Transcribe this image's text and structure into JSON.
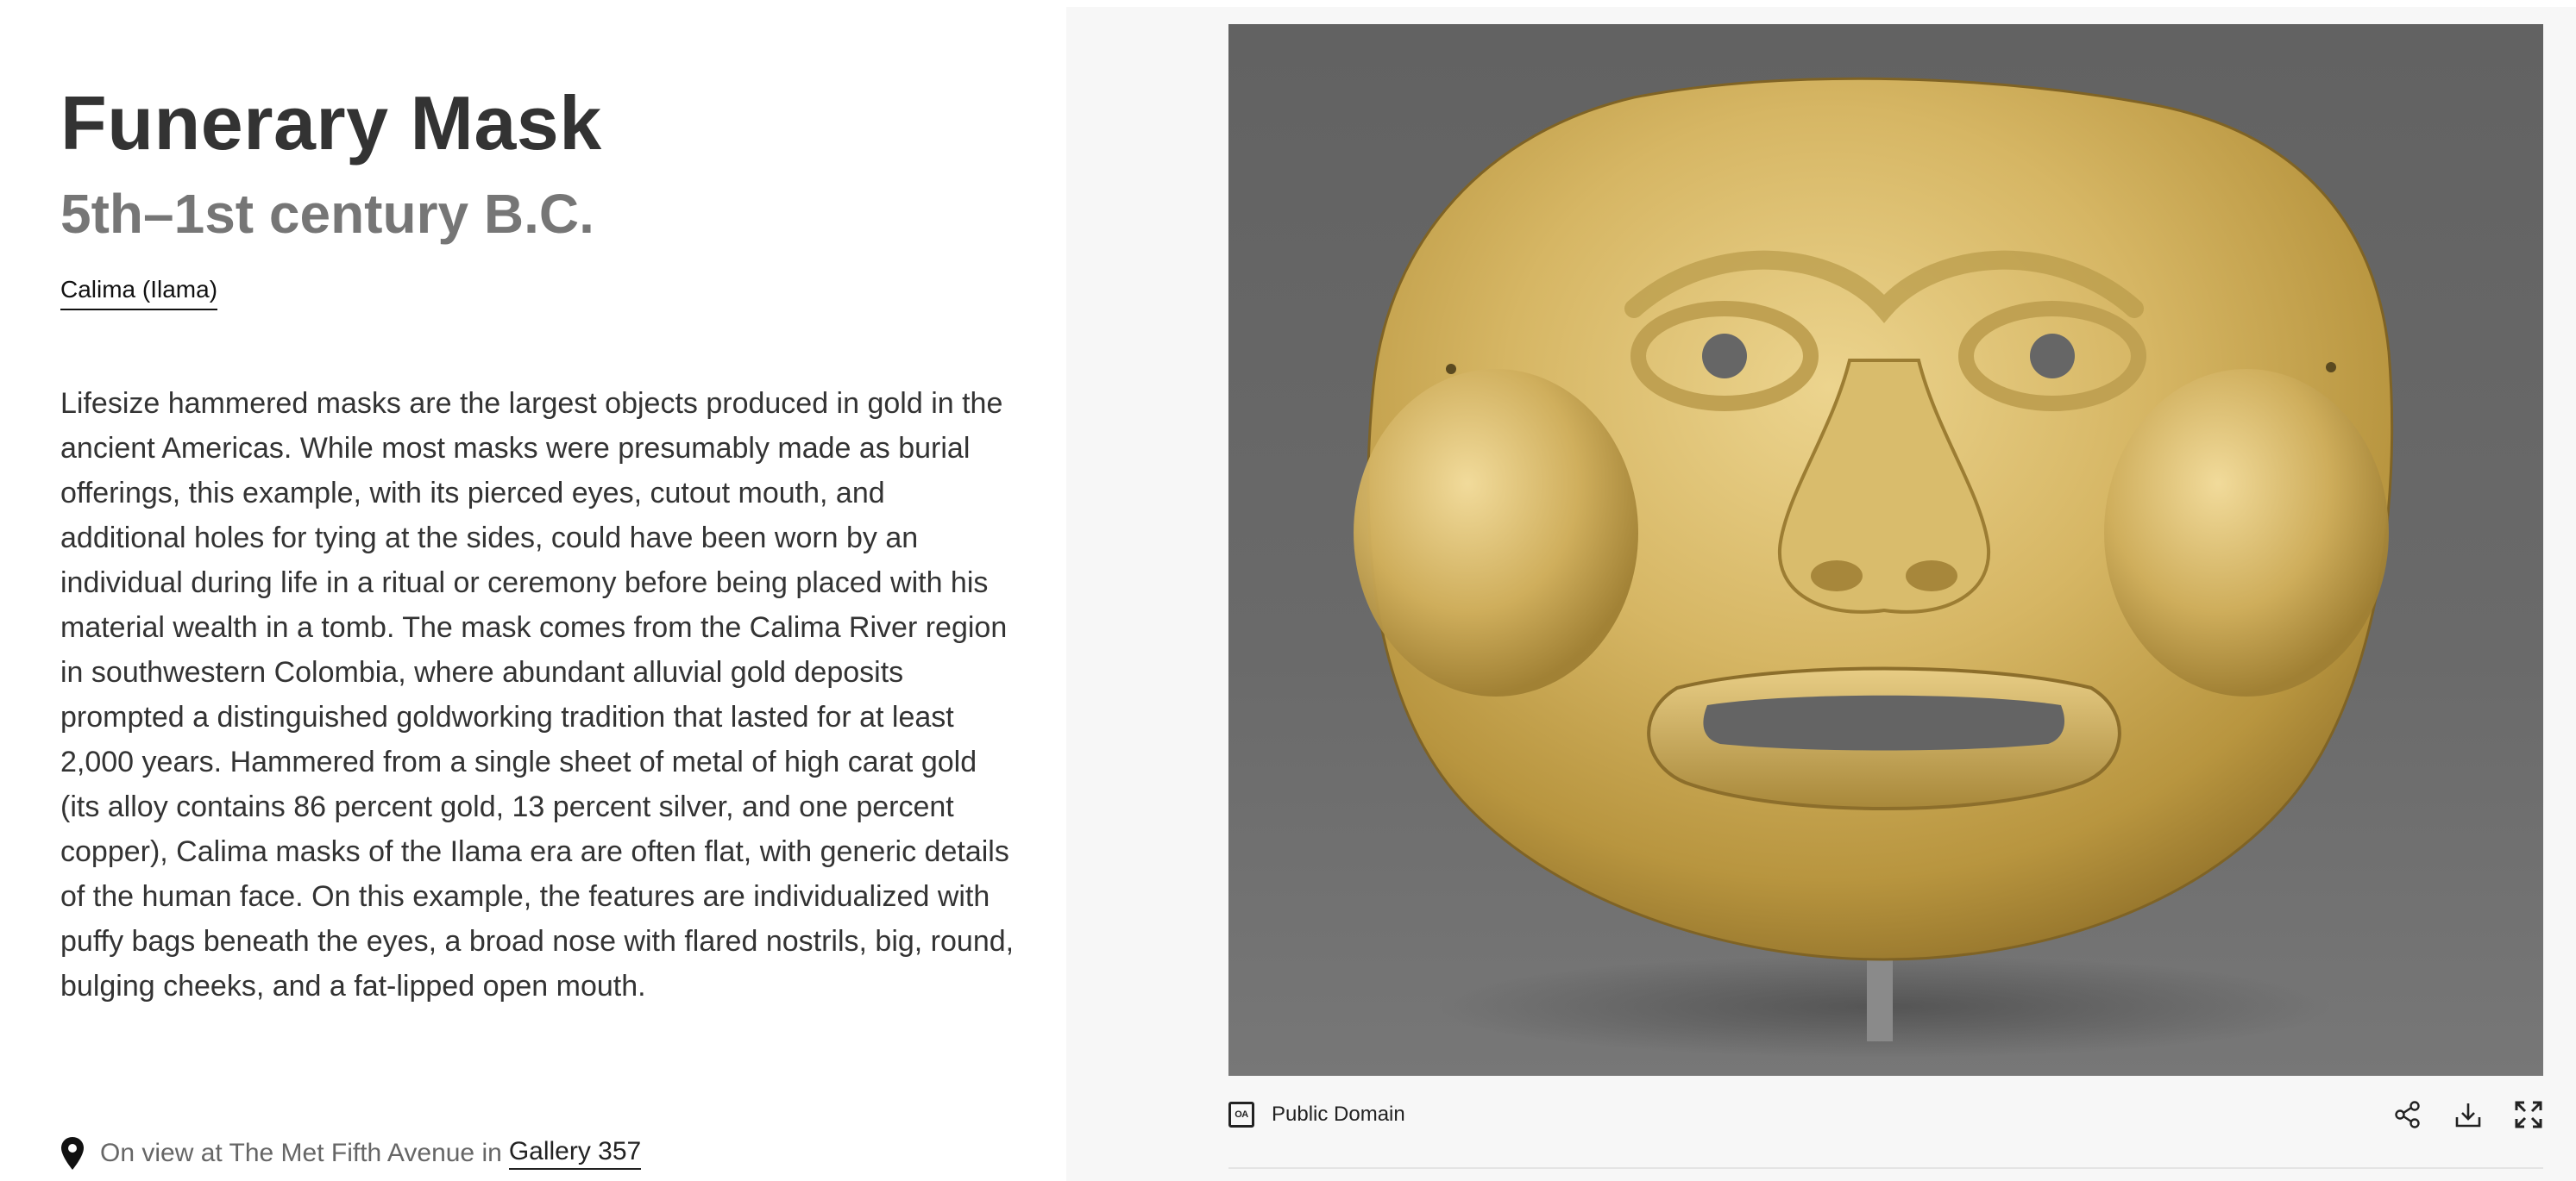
{
  "object": {
    "title": "Funerary Mask",
    "date": "5th–1st century B.C.",
    "culture": "Calima (Ilama)",
    "description": "Lifesize hammered masks are the largest objects produced in gold in the ancient Americas. While most masks were presumably made as burial offerings, this example, with its pierced eyes, cutout mouth, and additional holes for tying at the sides, could have been worn by an individual during life in a ritual or ceremony before being placed with his material wealth in a tomb. The mask comes from the Calima River region in southwestern Colombia, where abundant alluvial gold deposits prompted a distinguished goldworking tradition that lasted for at least 2,000 years. Hammered from a single sheet of metal of high carat gold (its alloy contains 86 percent gold, 13 percent silver, and one percent copper), Calima masks of the Ilama era are often flat, with generic details of the human face. On this example, the features are individualized with puffy bags beneath the eyes, a broad nose with flared nostrils, big, round, bulging cheeks, and a fat-lipped open mouth."
  },
  "location": {
    "icon": "map-pin-icon",
    "prefix": "On view at The Met Fifth Avenue in",
    "gallery": "Gallery 357"
  },
  "image": {
    "license_badge": "OA",
    "license_icon": "open-access-icon",
    "license": "Public Domain",
    "background_color": "#666666",
    "gold_color": "#d9b968"
  },
  "tools": [
    {
      "name": "share-button",
      "icon": "share-icon"
    },
    {
      "name": "download-button",
      "icon": "download-icon"
    },
    {
      "name": "fullscreen-button",
      "icon": "fullscreen-icon"
    }
  ]
}
